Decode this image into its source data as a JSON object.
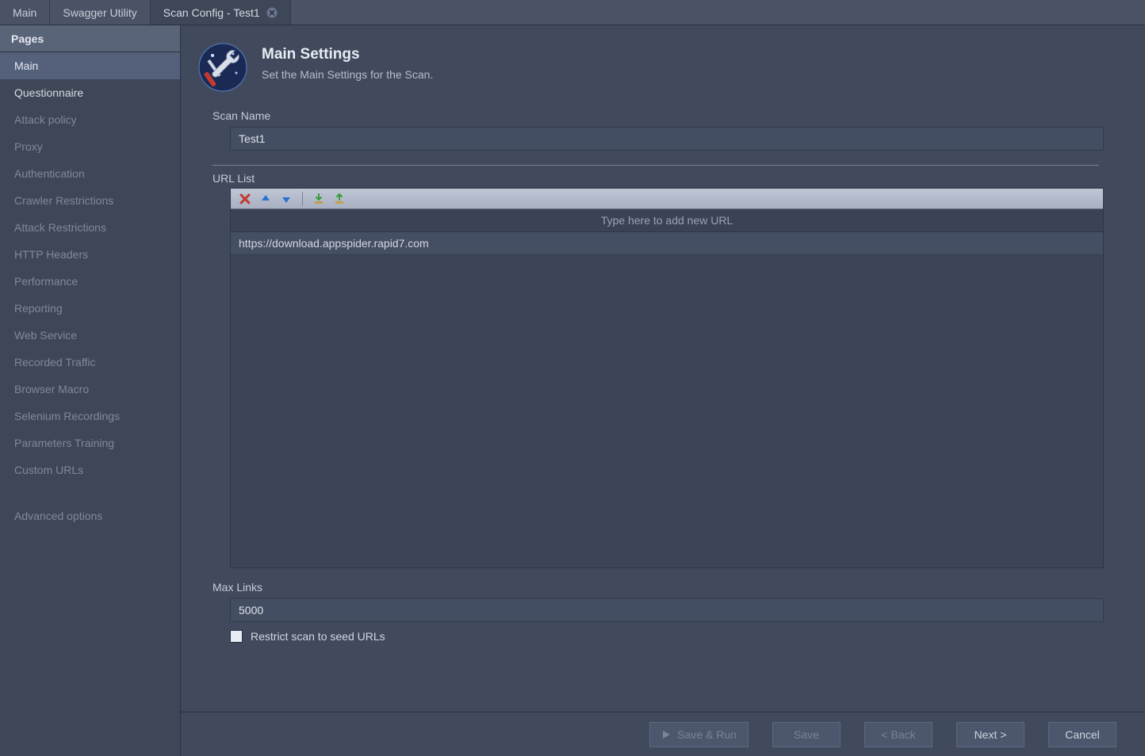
{
  "tabs": [
    {
      "label": "Main",
      "active": false,
      "closable": false
    },
    {
      "label": "Swagger Utility",
      "active": false,
      "closable": false
    },
    {
      "label": "Scan Config - Test1",
      "active": true,
      "closable": true
    }
  ],
  "sidebar": {
    "header": "Pages",
    "items": [
      {
        "label": "Main",
        "selected": true,
        "bright": false
      },
      {
        "label": "Questionnaire",
        "selected": false,
        "bright": true
      },
      {
        "label": "Attack policy"
      },
      {
        "label": "Proxy"
      },
      {
        "label": "Authentication"
      },
      {
        "label": "Crawler Restrictions"
      },
      {
        "label": "Attack Restrictions"
      },
      {
        "label": "HTTP Headers"
      },
      {
        "label": "Performance"
      },
      {
        "label": "Reporting"
      },
      {
        "label": "Web Service"
      },
      {
        "label": "Recorded Traffic"
      },
      {
        "label": "Browser Macro"
      },
      {
        "label": "Selenium Recordings"
      },
      {
        "label": "Parameters Training"
      },
      {
        "label": "Custom URLs"
      }
    ],
    "advanced_label": "Advanced options"
  },
  "header": {
    "title": "Main Settings",
    "subtitle": "Set the Main Settings for the Scan."
  },
  "scan_name": {
    "label": "Scan Name",
    "value": "Test1"
  },
  "url_list": {
    "label": "URL List",
    "add_placeholder": "Type here to add new URL",
    "items": [
      "https://download.appspider.rapid7.com"
    ]
  },
  "max_links": {
    "label": "Max Links",
    "value": "5000"
  },
  "restrict_checkbox": {
    "label": "Restrict scan to seed URLs",
    "checked": false
  },
  "footer": {
    "save_run": "Save & Run",
    "save": "Save",
    "back": "< Back",
    "next": "Next >",
    "cancel": "Cancel"
  }
}
